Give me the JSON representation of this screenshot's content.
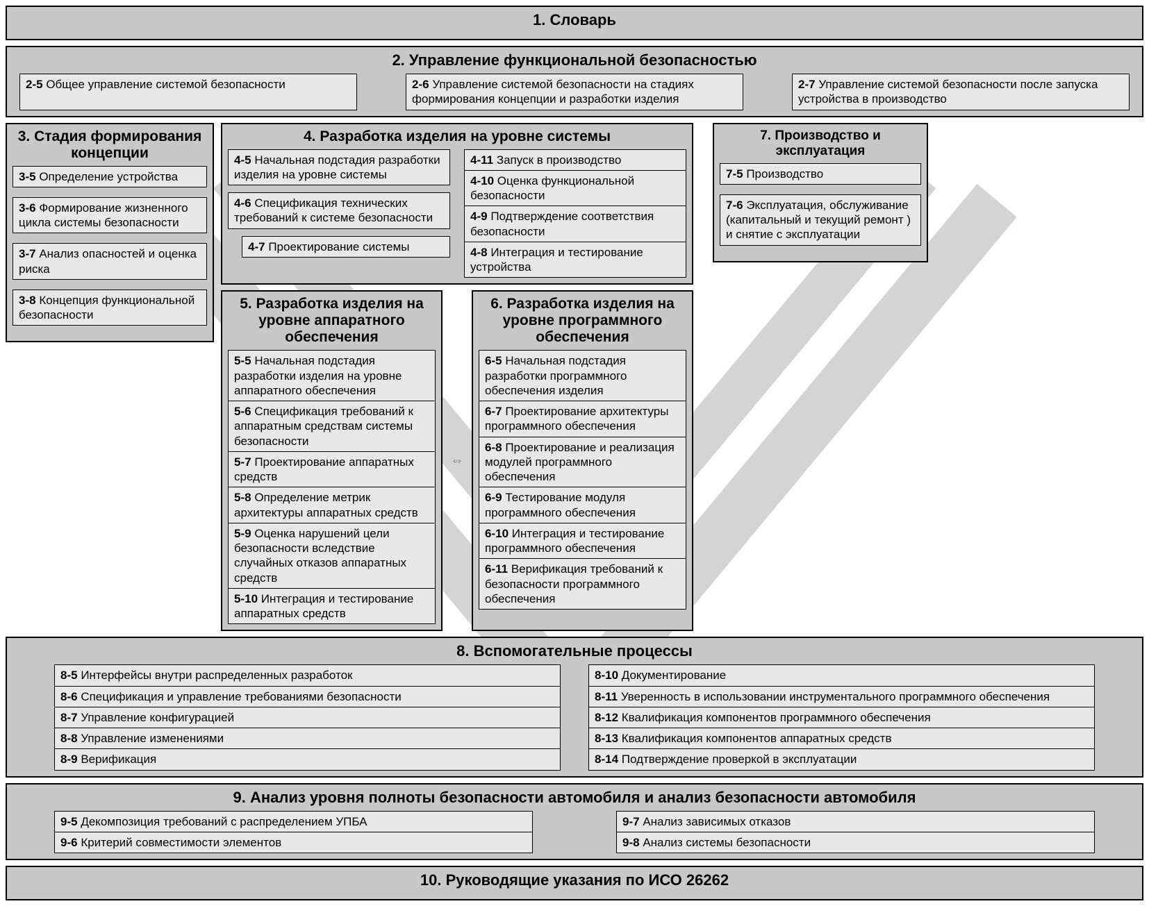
{
  "s1": {
    "title": "1. Словарь"
  },
  "s2": {
    "title": "2. Управление функциональной безопасностью",
    "items": [
      {
        "num": "2-5",
        "text": "Общее управление системой безопасности"
      },
      {
        "num": "2-6",
        "text": "Управление системой безопасности на стадиях формирования концепции и разработки изделия"
      },
      {
        "num": "2-7",
        "text": "Управление системой безопасности после запуска устройства в производство"
      }
    ]
  },
  "s3": {
    "title": "3. Стадия формирования концепции",
    "items": [
      {
        "num": "3-5",
        "text": "Определение устройства"
      },
      {
        "num": "3-6",
        "text": "Формирование жизненного цикла системы безопасности"
      },
      {
        "num": "3-7",
        "text": "Анализ опасностей и оценка риска"
      },
      {
        "num": "3-8",
        "text": "Концепция функциональной безопасности"
      }
    ]
  },
  "s4": {
    "title": "4. Разработка изделия на уровне системы",
    "left": [
      {
        "num": "4-5",
        "text": "Начальная подстадия разработки изделия на уровне системы"
      },
      {
        "num": "4-6",
        "text": "Спецификация технических требований к системе безопасности"
      },
      {
        "num": "4-7",
        "text": "Проектирование системы"
      }
    ],
    "right": [
      {
        "num": "4-11",
        "text": "Запуск в производство"
      },
      {
        "num": "4-10",
        "text": "Оценка функциональной безопасности"
      },
      {
        "num": "4-9",
        "text": "Подтверждение соответствия безопасности"
      },
      {
        "num": "4-8",
        "text": "Интеграция и тестирование устройства"
      }
    ]
  },
  "s5": {
    "title": "5. Разработка изделия на уровне аппаратного обеспечения",
    "items": [
      {
        "num": "5-5",
        "text": "Начальная подстадия разработки изделия на уровне аппаратного обеспечения"
      },
      {
        "num": "5-6",
        "text": "Спецификация требований к аппаратным средствам системы безопасности"
      },
      {
        "num": "5-7",
        "text": "Проектирование аппаратных средств"
      },
      {
        "num": "5-8",
        "text": "Определение метрик архитектуры аппаратных средств"
      },
      {
        "num": "5-9",
        "text": "Оценка нарушений цели безопас­ности вследствие случайных отказов аппаратных средств"
      },
      {
        "num": "5-10",
        "text": "Интеграция и тестирование аппаратных средств"
      }
    ]
  },
  "s6": {
    "title": "6. Разработка изделия на уровне программного обеспечения",
    "items": [
      {
        "num": "6-5",
        "text": "Начальная подстадия разработки программного обеспечения изделия"
      },
      {
        "num": "6-7",
        "text": "Проектирование архитектуры программного обеспечения"
      },
      {
        "num": "6-8",
        "text": "Проектирование и реализация модулей программного обеспечения"
      },
      {
        "num": "6-9",
        "text": "Тестирование модуля программного обеспечения"
      },
      {
        "num": "6-10",
        "text": "Интеграция и тестирование программного обеспечения"
      },
      {
        "num": "6-11",
        "text": "Верификация требований к безопасности программного обеспечения"
      }
    ]
  },
  "s7": {
    "title": "7. Производство и эксплуатация",
    "items": [
      {
        "num": "7-5",
        "text": "Производство"
      },
      {
        "num": "7-6",
        "text": "Эксплуатация, обслуживание (капитальный и текущий ремонт ) и снятие с эксплуатации"
      }
    ]
  },
  "s8": {
    "title": "8. Вспомогательные процессы",
    "left": [
      {
        "num": "8-5",
        "text": "Интерфейсы внутри распределенных разработок"
      },
      {
        "num": "8-6",
        "text": "Спецификация и управление требованиями безопасности"
      },
      {
        "num": "8-7",
        "text": "Управление конфигурацией"
      },
      {
        "num": "8-8",
        "text": "Управление изменениями"
      },
      {
        "num": "8-9",
        "text": "Верификация"
      }
    ],
    "right": [
      {
        "num": "8-10",
        "text": "Документирование"
      },
      {
        "num": "8-11",
        "text": "Уверенность в использовании инструментального программного обеспечения"
      },
      {
        "num": "8-12",
        "text": "Квалификация компонентов программного обеспечения"
      },
      {
        "num": "8-13",
        "text": "Квалификация компонентов аппаратных средств"
      },
      {
        "num": "8-14",
        "text": "Подтверждение проверкой в эксплуатации"
      }
    ]
  },
  "s9": {
    "title": "9. Анализ уровня полноты безопасности автомобиля и анализ безопасности автомобиля",
    "left": [
      {
        "num": "9-5",
        "text": "Декомпозиция требований с распределением УПБА"
      },
      {
        "num": "9-6",
        "text": "Критерий совместимости элементов"
      }
    ],
    "right": [
      {
        "num": "9-7",
        "text": "Анализ зависимых отказов"
      },
      {
        "num": "9-8",
        "text": "Анализ системы безопасности"
      }
    ]
  },
  "s10": {
    "title": "10. Руководящие указания по ИСО 26262"
  },
  "arrow": "⇔"
}
